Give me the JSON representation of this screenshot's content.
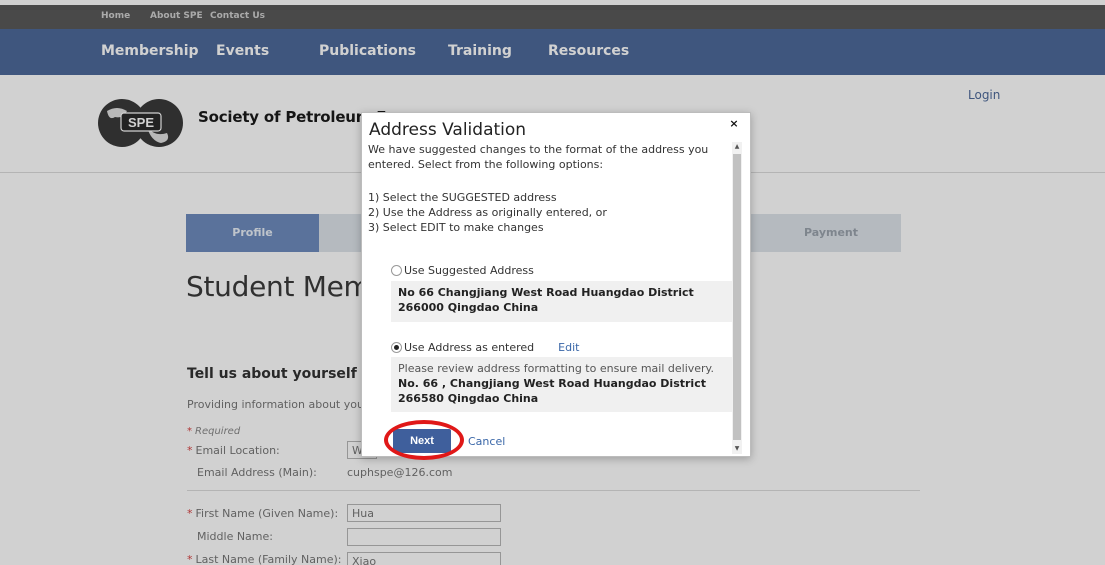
{
  "topbar": {
    "links": [
      "Home",
      "About SPE",
      "Contact Us"
    ]
  },
  "mainnav": {
    "items": [
      "Membership",
      "Events",
      "Publications",
      "Training",
      "Resources"
    ]
  },
  "header": {
    "login": "Login",
    "org_name": "Society of Petroleum Eng"
  },
  "tabs": {
    "profile": "Profile",
    "payment": "Payment"
  },
  "page": {
    "title": "Student Mem",
    "section_heading": "Tell us about yourself",
    "section_text": "Providing information about you",
    "required_note": "Required"
  },
  "form": {
    "email_location_label": "Email Location:",
    "email_location_value": "W",
    "email_address_label": "Email Address (Main):",
    "email_address_value": "cuphspe@126.com",
    "first_name_label": "First Name (Given Name):",
    "first_name_value": "Hua",
    "middle_name_label": "Middle Name:",
    "middle_name_value": "",
    "last_name_label": "Last Name (Family Name):",
    "last_name_value": "Xiao"
  },
  "modal": {
    "title": "Address Validation",
    "close_glyph": "×",
    "intro": "We have suggested changes to the format of the address you entered. Select from the following options:",
    "options": [
      "1) Select the SUGGESTED address",
      "2) Use the Address as originally entered, or",
      "3) Select EDIT to make changes"
    ],
    "suggested_label": "Use Suggested Address",
    "suggested_line1": "No 66 Changjiang West Road Huangdao District",
    "suggested_line2": "266000 Qingdao China",
    "entered_label": "Use Address as entered",
    "edit_label": "Edit",
    "entered_note": "Please review address formatting to ensure mail delivery.",
    "entered_line1": "No. 66 , Changjiang West Road Huangdao District",
    "entered_line2": "266580 Qingdao China",
    "next_label": "Next",
    "cancel_label": "Cancel",
    "selected_option": "entered"
  },
  "colors": {
    "nav_bg": "#4e6a9a",
    "button_bg": "#3f5f9c",
    "link": "#3a67a8",
    "highlight_ring": "#e01818"
  }
}
